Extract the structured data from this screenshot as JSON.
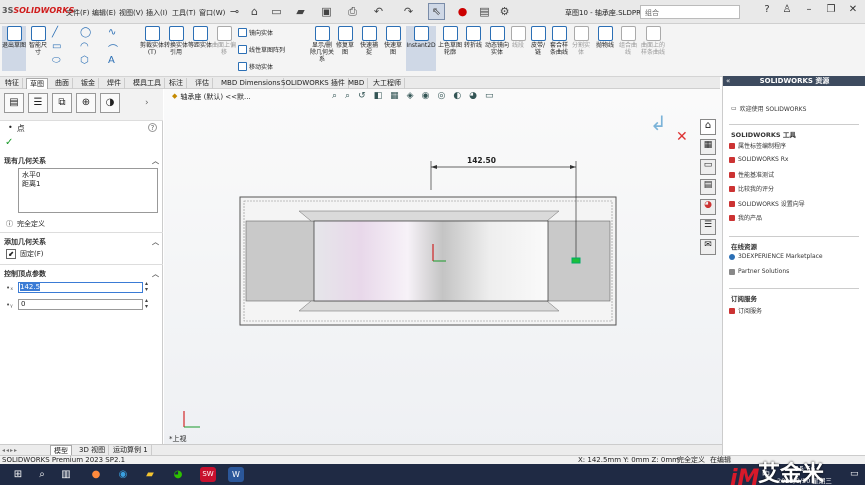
{
  "app": {
    "logo_brand": "3S",
    "logo_text": "SOLIDWORKS",
    "doc_title": "草图10 - 轴承座.SLDPRT *",
    "search_placeholder": "组合",
    "status_left": "SOLIDWORKS Premium 2023 SP2.1",
    "status_coord": "X: 142.5mm Y: 0mm Z: 0mm",
    "status_state": "完全定义",
    "status_edit": "在编辑"
  },
  "menu": [
    "文件(F)",
    "编辑(E)",
    "视图(V)",
    "插入(I)",
    "工具(T)",
    "窗口(W)"
  ],
  "ribbon": {
    "big": [
      {
        "label": "退出草图",
        "color": "#2b6fb5"
      },
      {
        "label": "智能尺寸",
        "color": "#2b6fb5"
      },
      {
        "label": "剪裁实体(T)",
        "color": "#2b6fb5"
      },
      {
        "label": "转换实体引用",
        "color": "#2b6fb5"
      },
      {
        "label": "等距实体",
        "color": "#2b6fb5"
      },
      {
        "label": "曲面上偏移",
        "color": "#aaa"
      }
    ],
    "mirror": "镜向实体",
    "linear": "线性草图阵列",
    "move": "移动实体",
    "big2": [
      {
        "label": "显示/删除几何关系",
        "color": "#2b6fb5"
      },
      {
        "label": "修复草图",
        "color": "#2b6fb5"
      },
      {
        "label": "快速捕捉",
        "color": "#2b6fb5"
      },
      {
        "label": "快速草图",
        "color": "#2b6fb5"
      },
      {
        "label": "Instant2D",
        "color": "#2b6fb5"
      },
      {
        "label": "上色草图轮廓",
        "color": "#2b6fb5"
      },
      {
        "label": "转折线",
        "color": "#2b6fb5"
      },
      {
        "label": "动态镜向实体",
        "color": "#2b6fb5"
      },
      {
        "label": "线段",
        "color": "#aaa"
      },
      {
        "label": "皮带/链",
        "color": "#2b6fb5"
      },
      {
        "label": "套合样条曲线",
        "color": "#2b6fb5"
      },
      {
        "label": "分割实体",
        "color": "#aaa"
      },
      {
        "label": "抛物线",
        "color": "#2b6fb5"
      },
      {
        "label": "组合曲线",
        "color": "#aaa"
      },
      {
        "label": "曲面上的样条曲线",
        "color": "#aaa"
      }
    ]
  },
  "tabs": [
    "特征",
    "草图",
    "曲面",
    "钣金",
    "焊件",
    "模具工具",
    "标注",
    "评估",
    "MBD Dimensions",
    "SOLIDWORKS 插件",
    "MBD",
    "大工程师"
  ],
  "left_panel": {
    "title": "点",
    "existing_relations": "现有几何关系",
    "relations": [
      "水平0",
      "距离1"
    ],
    "fully_defined": "完全定义",
    "add_relations": "添加几何关系",
    "fix": "固定(F)",
    "params": "控制顶点参数",
    "x_value": "142.5",
    "y_value": "0"
  },
  "viewport": {
    "tree_label": "轴承座 (默认) <<默...",
    "dimension": "142.50",
    "view_label": "*上视"
  },
  "right_panel": {
    "header": "SOLIDWORKS 资源",
    "welcome": "欢迎使用 SOLIDWORKS",
    "tools_title": "SOLIDWORKS 工具",
    "tools": [
      "属性标签编制程序",
      "SOLIDWORKS Rx",
      "性能基准测试",
      "比较我的评分",
      "SOLIDWORKS 设置向导",
      "我的产品"
    ],
    "online_title": "在线资源",
    "online": [
      "3DEXPERIENCE Marketplace",
      "Partner Solutions"
    ],
    "sub_title": "订阅服务",
    "sub": [
      "订阅服务"
    ]
  },
  "bottom_tabs": [
    "模型",
    "3D 视图",
    "运动算例 1"
  ],
  "taskbar": {
    "time": "15:56",
    "date": "2023/8/30 星期三",
    "ime": "中"
  },
  "watermark": {
    "logo": "iM",
    "text": "艾金米"
  }
}
